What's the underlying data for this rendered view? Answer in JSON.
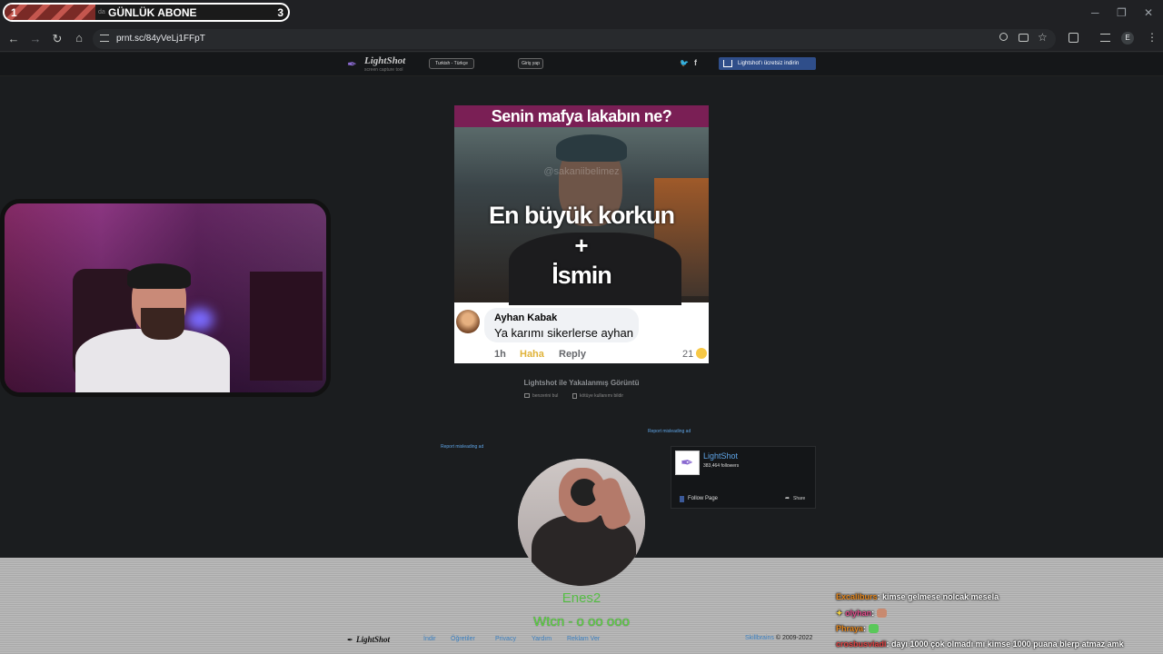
{
  "browser": {
    "tab": {
      "num_left": "1",
      "tiny_text": "da",
      "title": "GÜNLÜK ABONE",
      "num_right": "3"
    },
    "window_controls": {
      "minimize": "─",
      "restore": "❐",
      "close": "✕"
    },
    "nav": {
      "back": "←",
      "forward": "→",
      "reload": "↻",
      "home": "⌂"
    },
    "url": "prnt.sc/84yVeLj1FFpT",
    "profile_initial": "E"
  },
  "lightshot": {
    "logo": "LightShot",
    "logo_sub": "screen capture tool",
    "language": "Turkish - Türkçe",
    "login": "Giriş yap",
    "download": "Lightshot'ı ücretsiz indirin",
    "caption": "Lightshot ile Yakalanmış Görüntü",
    "find_similar": "benzerini bul",
    "report_abuse": "kötüye kullanımı bildir",
    "report_ad_right": "Report misleading ad",
    "report_ad_left": "Report misleading ad",
    "footer": {
      "logo": "LightShot",
      "links": [
        "İndir",
        "Öğretiler",
        "Privacy",
        "Yardım",
        "Reklam Ver"
      ],
      "company": "Skillbrains",
      "copyright": " © 2009-2022"
    }
  },
  "meme": {
    "question": "Senin mafya lakabın ne?",
    "watermark": "@sakaniibelimez",
    "line1": "En büyük korkun",
    "plus": "+",
    "line2": "İsmin",
    "comment": {
      "name": "Ayhan Kabak",
      "text": "Ya karımı sikerlerse ayhan",
      "time": "1h",
      "reaction": "Haha",
      "reply": "Reply",
      "count": "21"
    }
  },
  "fb_widget": {
    "name": "LightShot",
    "followers": "383,464 followers",
    "follow": "Follow Page",
    "share": "Share"
  },
  "stream": {
    "name": "Enes2",
    "subtitle": "Wtcn - o oo ooo"
  },
  "chat": [
    {
      "user": "Excaliburs",
      "user_color": "#e8891e",
      "message": "kimse gelmese nolcak mesela"
    },
    {
      "user": "olyhan",
      "user_color": "#e04a8a",
      "message": ""
    },
    {
      "user": "Phraya",
      "user_color": "#e8891e",
      "message": ""
    },
    {
      "user": "crosbusviadi",
      "user_color": "#e04040",
      "message": "dayı 1000 çok olmadı mı kimse 1000 puana blerp atmaz amk"
    }
  ]
}
